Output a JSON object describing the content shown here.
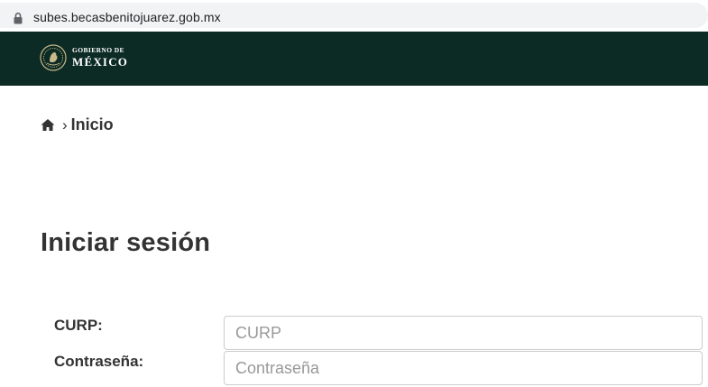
{
  "browser": {
    "url": "subes.becasbenitojuarez.gob.mx",
    "lock_icon": "lock-icon"
  },
  "header": {
    "logo_line1": "GOBIERNO DE",
    "logo_line2": "MÉXICO",
    "seal_icon": "coat-of-arms-icon",
    "background_color": "#0c2b24"
  },
  "breadcrumb": {
    "home_icon": "home-icon",
    "separator": "›",
    "current": "Inicio"
  },
  "page": {
    "title": "Iniciar sesión"
  },
  "form": {
    "curp_label": "CURP:",
    "curp_placeholder": "CURP",
    "password_label": "Contraseña:",
    "password_placeholder": "Contraseña"
  }
}
